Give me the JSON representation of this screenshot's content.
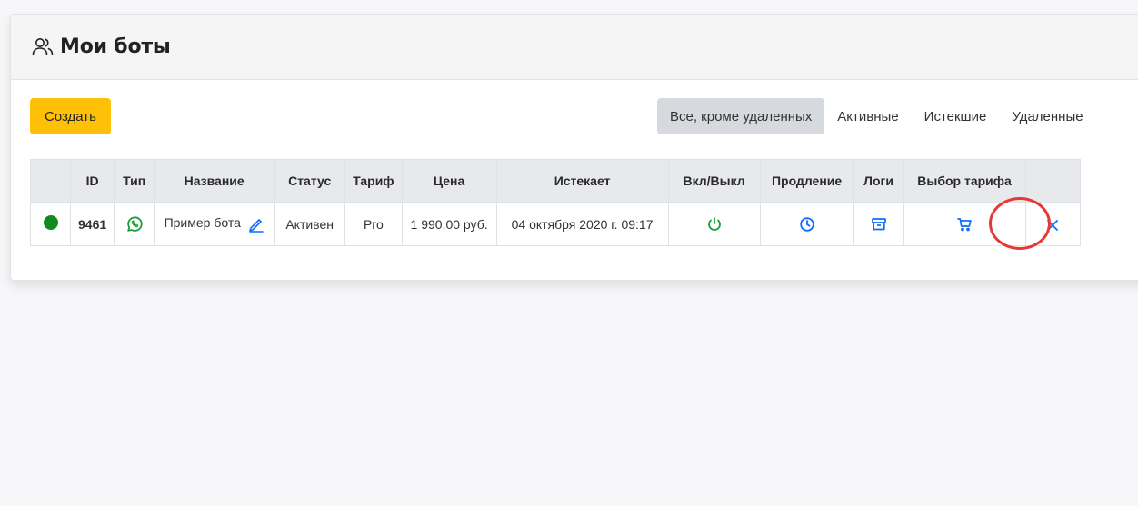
{
  "header": {
    "title": "Мои боты",
    "icon": "users-icon"
  },
  "toolbar": {
    "create_label": "Создать",
    "filters": [
      {
        "label": "Все, кроме удаленных",
        "active": true
      },
      {
        "label": "Активные",
        "active": false
      },
      {
        "label": "Истекшие",
        "active": false
      },
      {
        "label": "Удаленные",
        "active": false
      }
    ]
  },
  "table": {
    "columns": [
      "",
      "ID",
      "Тип",
      "Название",
      "Статус",
      "Тариф",
      "Цена",
      "Истекает",
      "Вкл/Выкл",
      "Продление",
      "Логи",
      "Выбор тарифа",
      ""
    ],
    "rows": [
      {
        "status_dot_color": "#138a1e",
        "id": "9461",
        "type_icon": "whatsapp-icon",
        "name": "Пример бота",
        "status": "Активен",
        "tariff": "Pro",
        "price": "1 990,00 руб.",
        "expires": "04 октября 2020 г. 09:17"
      }
    ]
  },
  "colors": {
    "accent_yellow": "#ffc107",
    "green": "#138a1e",
    "blue": "#0d6efd",
    "highlight_red": "#e53935"
  }
}
